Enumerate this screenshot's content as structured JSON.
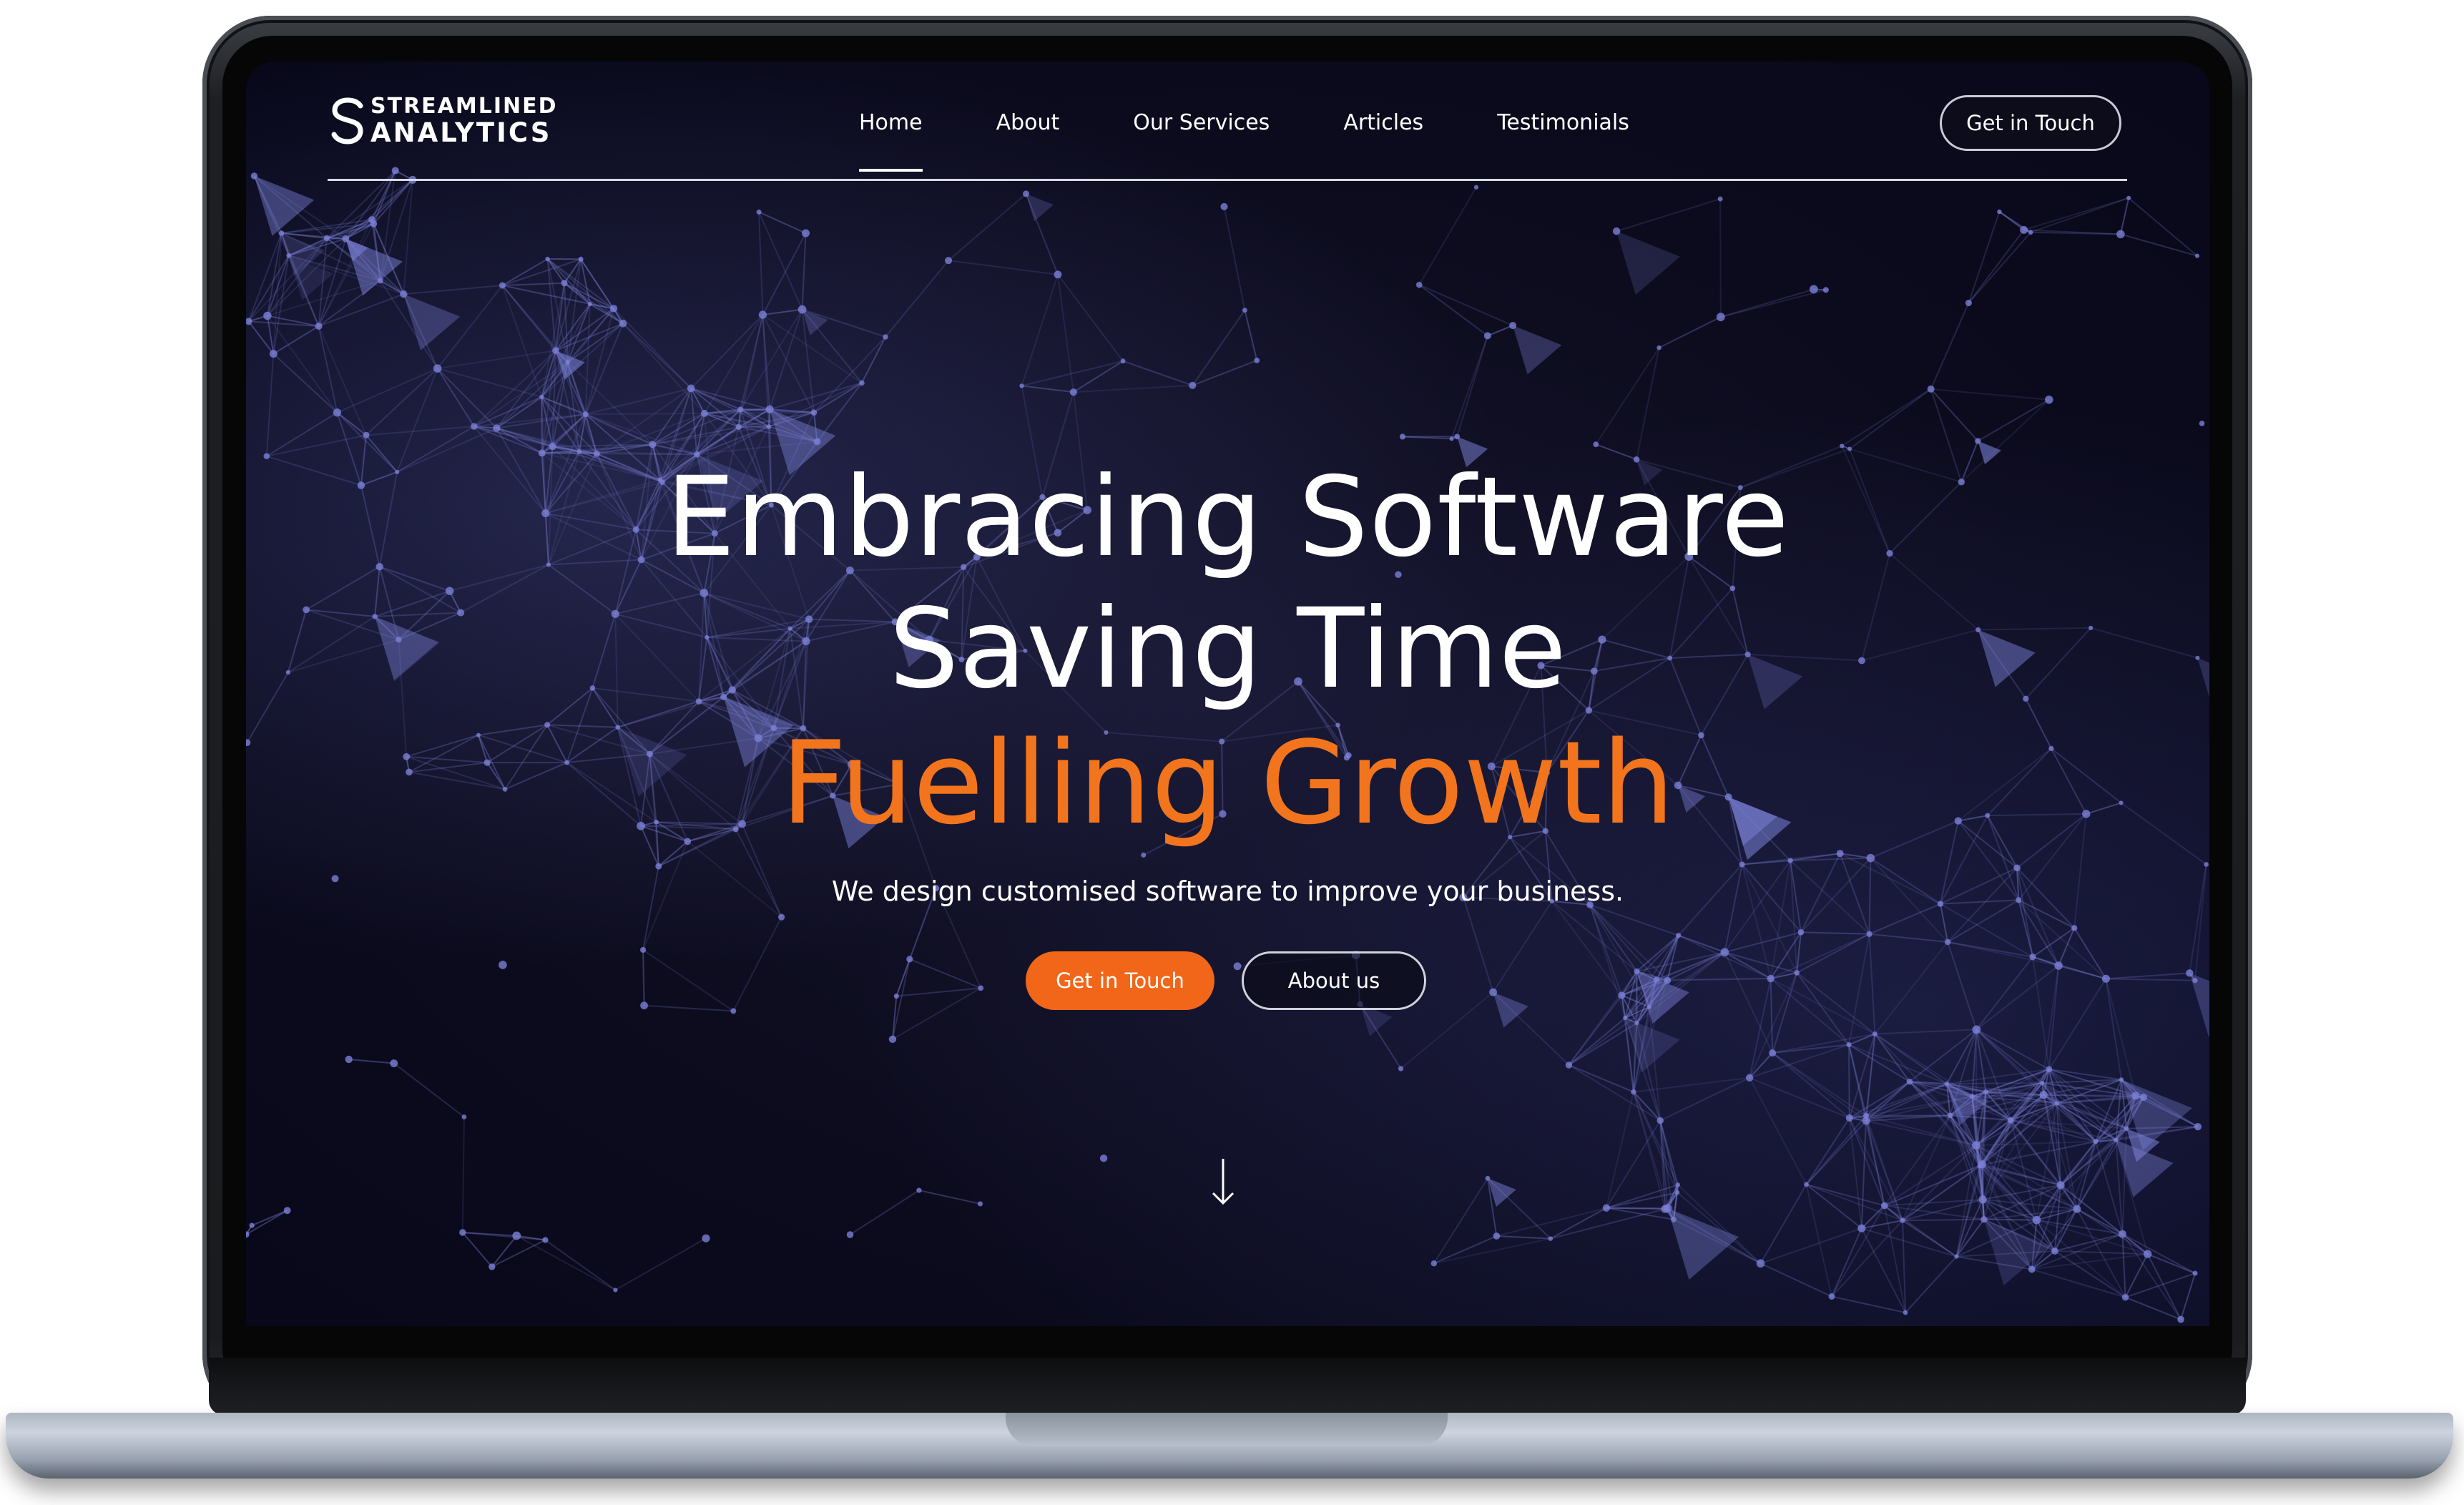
{
  "header": {
    "logo_line1": "STREAMLINED",
    "logo_line2": "ANALYTICS",
    "nav": [
      {
        "label": "Home",
        "active": true
      },
      {
        "label": "About",
        "active": false
      },
      {
        "label": "Our Services",
        "active": false
      },
      {
        "label": "Articles",
        "active": false
      },
      {
        "label": "Testimonials",
        "active": false
      }
    ],
    "cta_label": "Get in Touch"
  },
  "hero": {
    "line1": "Embracing Software",
    "line2": "Saving Time",
    "line3": "Fuelling Growth",
    "subtitle": "We design customised software to improve your business.",
    "primary_button": "Get in Touch",
    "secondary_button": "About us"
  },
  "colors": {
    "accent": "#f2751d",
    "background": "#0c0b1d",
    "network": "#7a80d6"
  },
  "icons": {
    "scroll": "arrow-down-icon",
    "logo": "s-logo-mark"
  }
}
